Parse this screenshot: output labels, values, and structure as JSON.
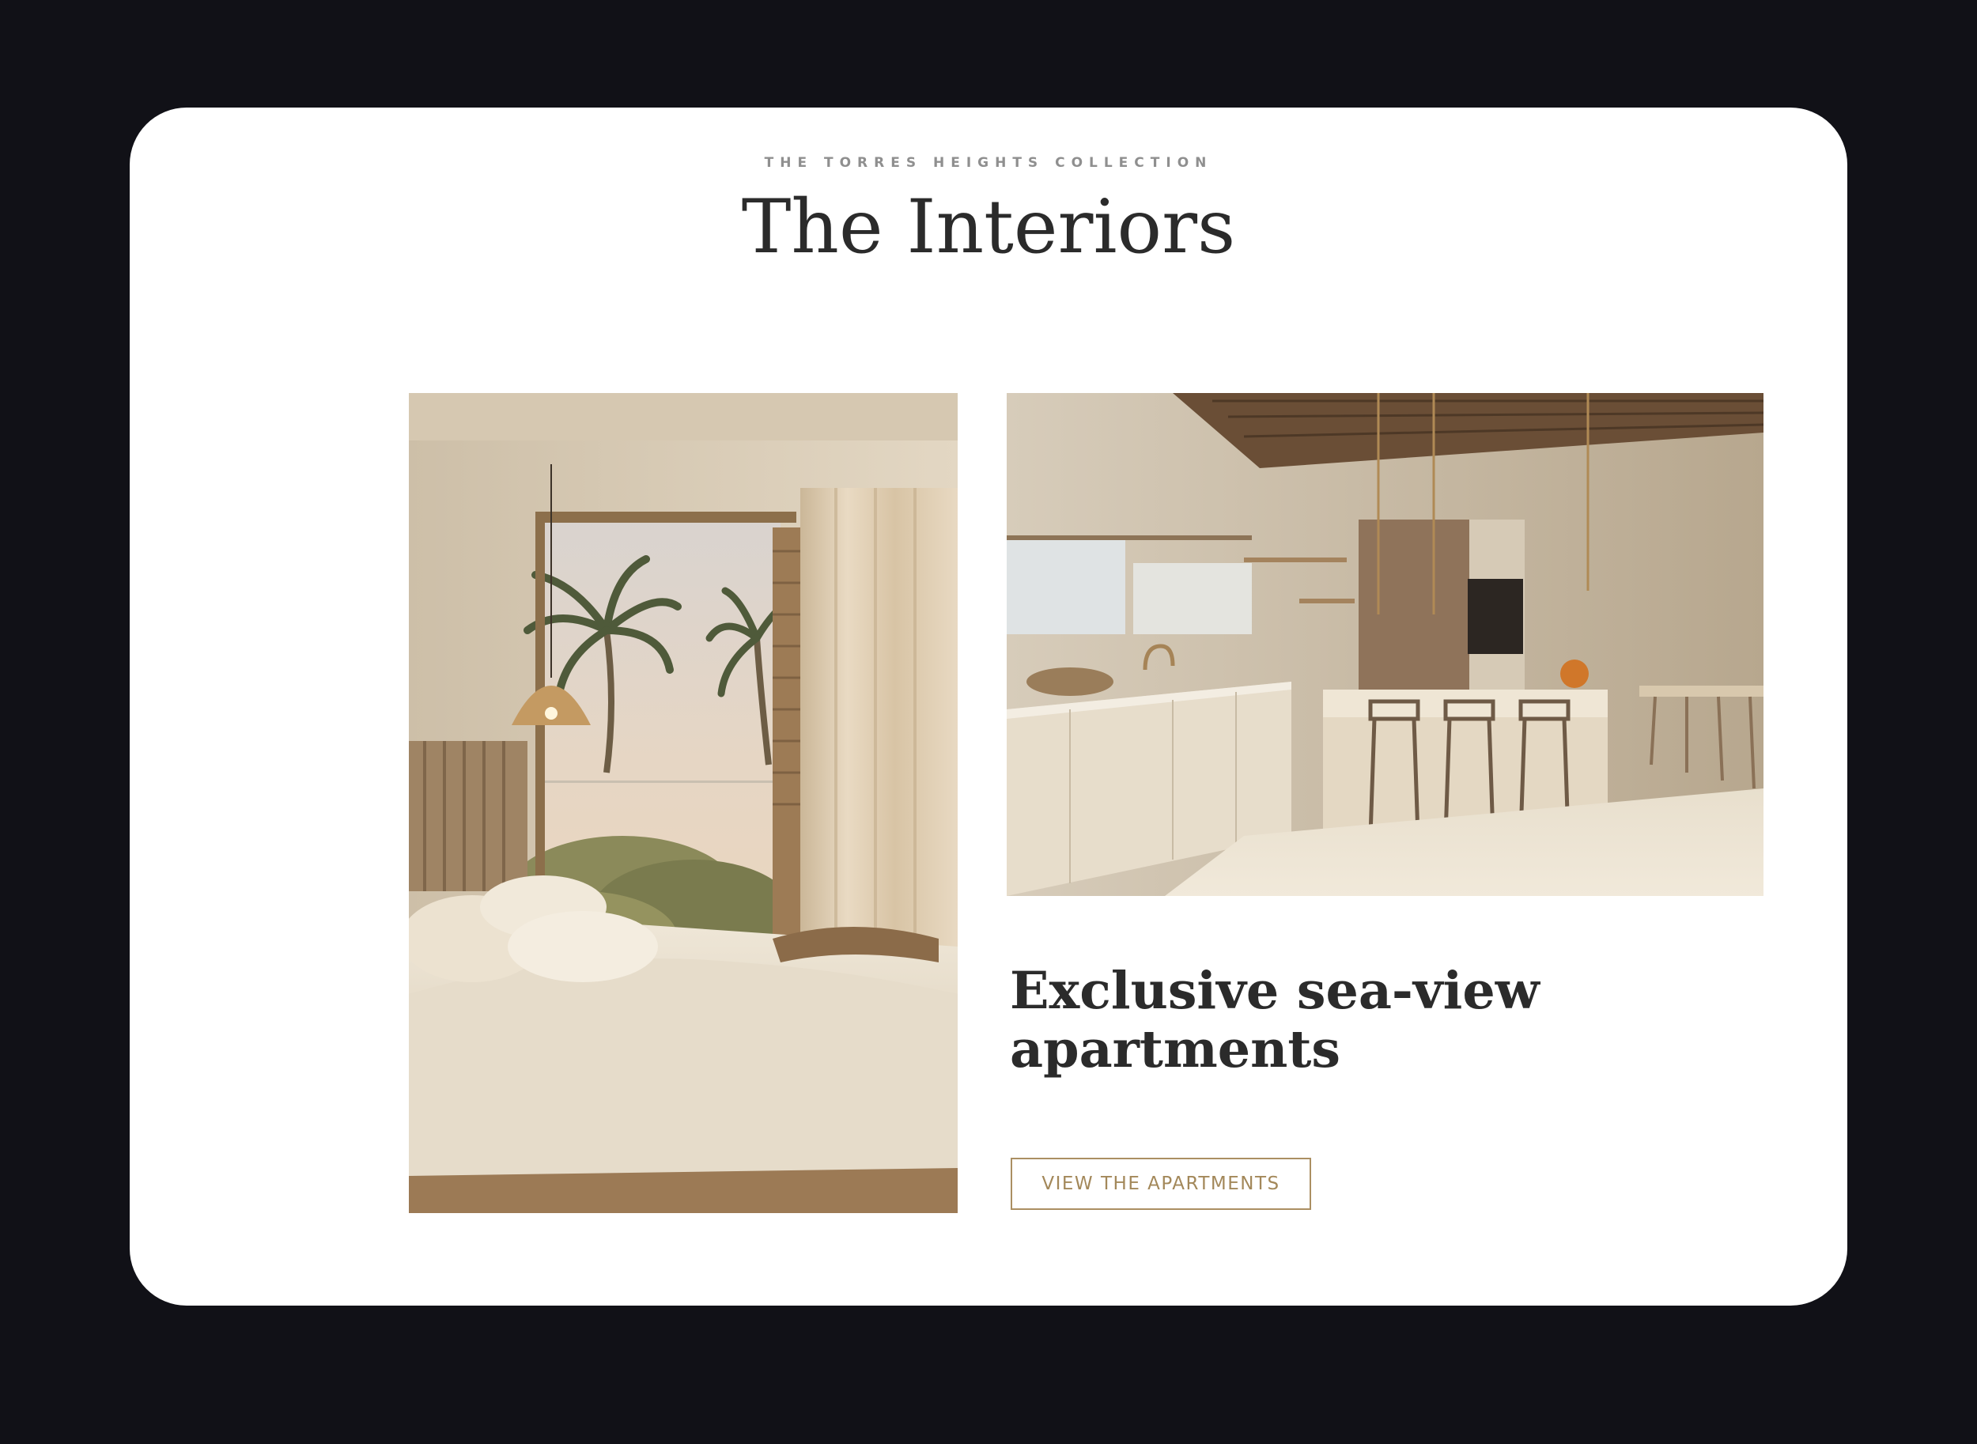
{
  "eyebrow": "THE TORRES HEIGHTS COLLECTION",
  "title": "The Interiors",
  "images": {
    "bedroom_alt": "Bedroom interior with palm view",
    "kitchen_alt": "Open kitchen and dining interior"
  },
  "feature": {
    "headline_line1": "Exclusive sea-view",
    "headline_line2": "apartments",
    "cta_label": "VIEW THE APARTMENTS"
  },
  "colors": {
    "background": "#111117",
    "card": "#ffffff",
    "heading": "#2b2b2b",
    "accent": "#ab8f62",
    "eyebrow": "#8f8f8f"
  }
}
